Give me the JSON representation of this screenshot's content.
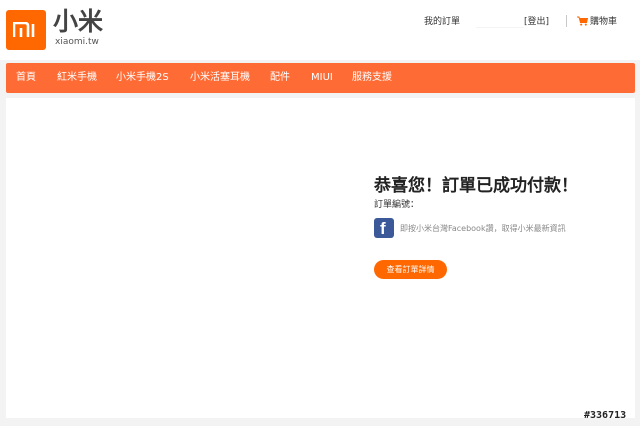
{
  "header": {
    "logo_icon": "mi-logo-icon",
    "brand_name": "小米",
    "brand_domain": "xiaomi.tw",
    "my_orders": "我的訂單",
    "logout": "[登出]",
    "cart_icon": "shopping-cart-icon",
    "cart": "購物車"
  },
  "nav": {
    "items": [
      {
        "label": "首頁"
      },
      {
        "label": "紅米手機"
      },
      {
        "label": "小米手機2S"
      },
      {
        "label": "小米活塞耳機"
      },
      {
        "label": "配件"
      },
      {
        "label": "MIUI"
      },
      {
        "label": "服務支援"
      }
    ]
  },
  "main": {
    "title": "恭喜您！訂單已成功付款！",
    "order_number_label": "訂單編號：",
    "facebook_icon": "facebook-icon",
    "facebook_text": "即按小米台灣Facebook讚，取得小米最新資訊",
    "detail_button": "查看訂單詳情"
  },
  "watermark": "#336713",
  "colors": {
    "brand_orange": "#ff6700",
    "nav_orange": "#ff6b35",
    "facebook_blue": "#3b5998"
  }
}
